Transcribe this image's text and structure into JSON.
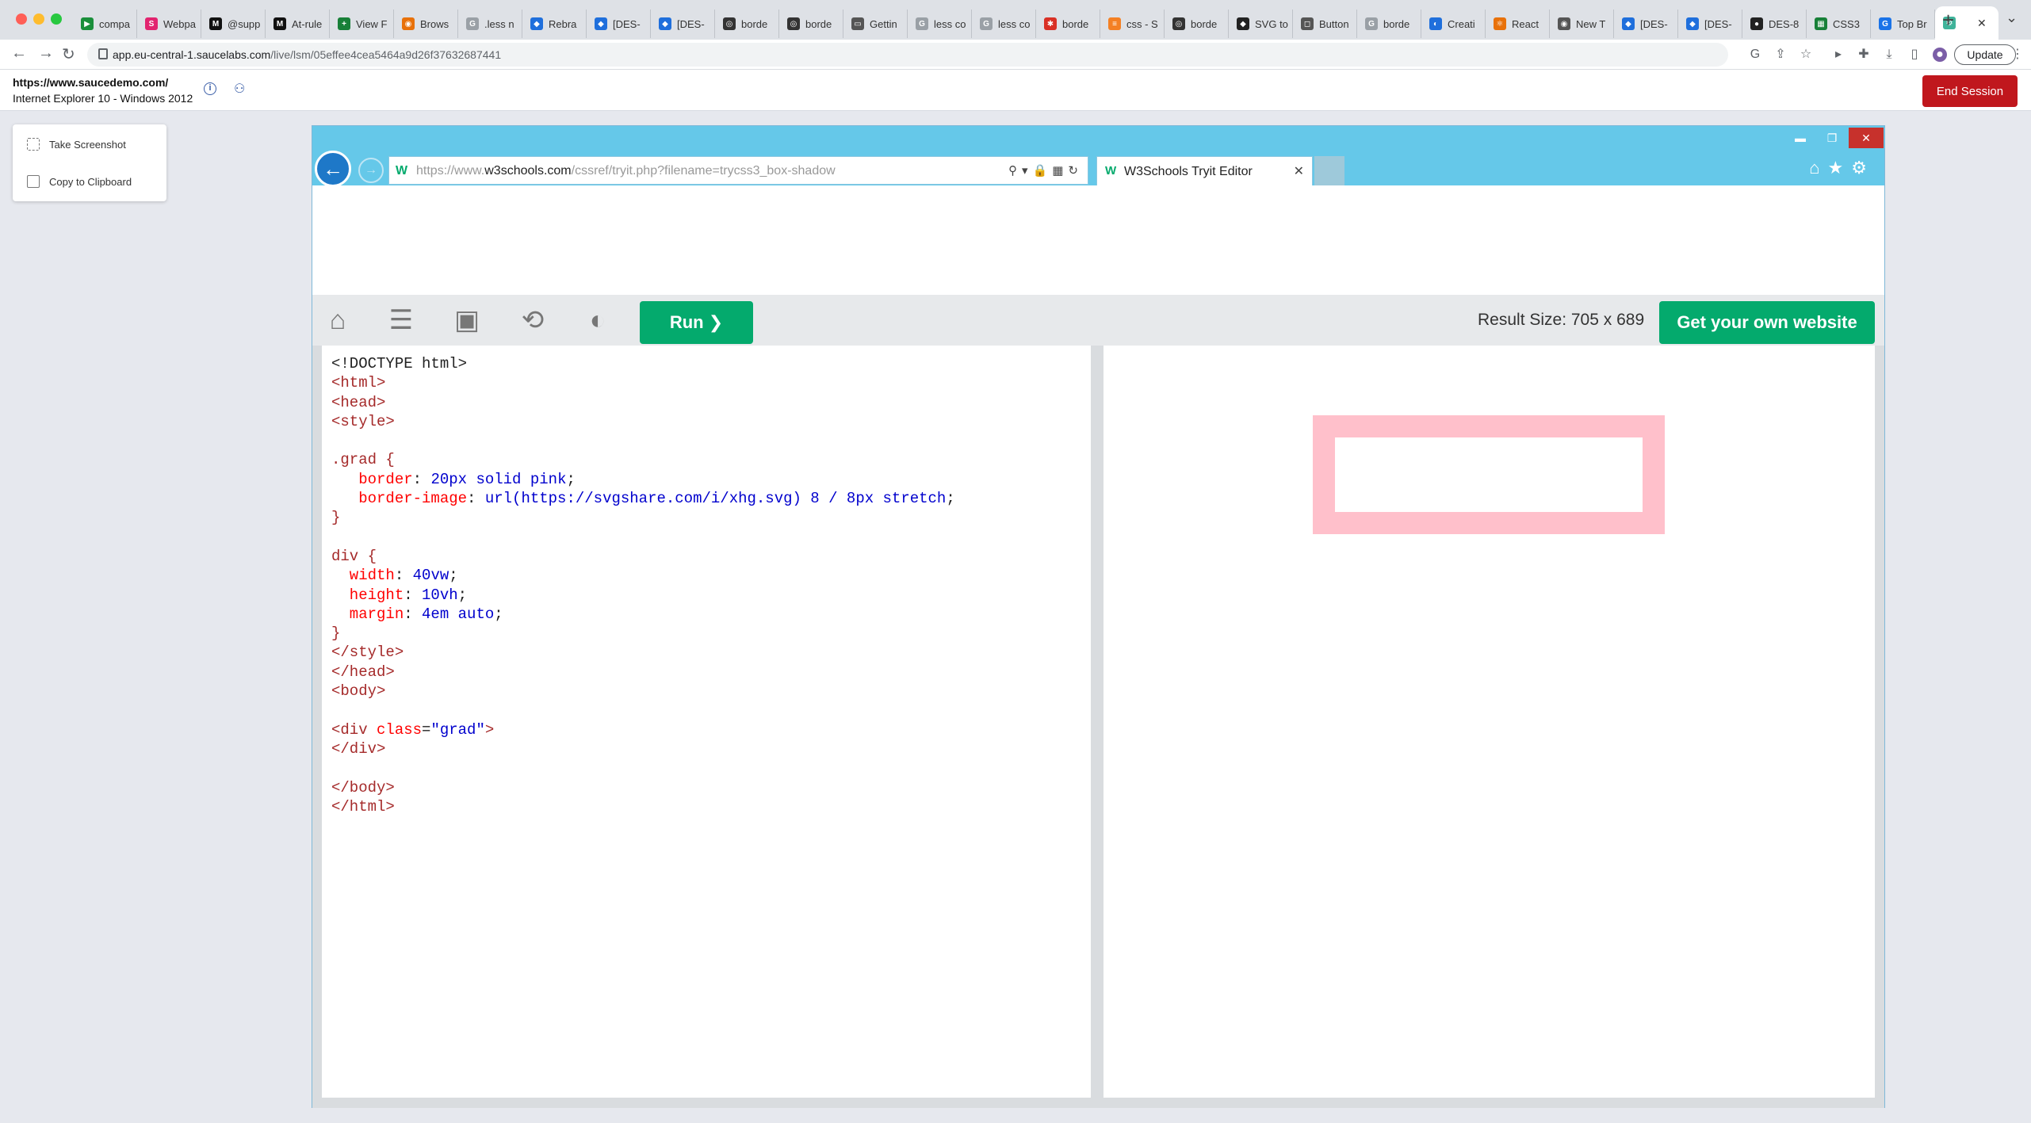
{
  "browser": {
    "tabs": [
      {
        "label": "compa",
        "color": "#1a8f3b",
        "glyph": "▶"
      },
      {
        "label": "Webpa",
        "color": "#e2246f",
        "glyph": "S"
      },
      {
        "label": "@supp",
        "color": "#111111",
        "glyph": "M"
      },
      {
        "label": "At-rule",
        "color": "#111111",
        "glyph": "M"
      },
      {
        "label": "View F",
        "color": "#188038",
        "glyph": "+"
      },
      {
        "label": "Brows",
        "color": "#e8710a",
        "glyph": "◉"
      },
      {
        "label": ".less n",
        "color": "#9aa0a6",
        "glyph": "G"
      },
      {
        "label": "Rebra",
        "color": "#1f6fdc",
        "glyph": "◆"
      },
      {
        "label": "[DES-",
        "color": "#1f6fdc",
        "glyph": "◆"
      },
      {
        "label": "[DES-",
        "color": "#1f6fdc",
        "glyph": "◆"
      },
      {
        "label": "borde",
        "color": "#333333",
        "glyph": "◎"
      },
      {
        "label": "borde",
        "color": "#333333",
        "glyph": "◎"
      },
      {
        "label": "Gettin",
        "color": "#555555",
        "glyph": "▭"
      },
      {
        "label": "less co",
        "color": "#9aa0a6",
        "glyph": "G"
      },
      {
        "label": "less co",
        "color": "#9aa0a6",
        "glyph": "G"
      },
      {
        "label": "borde",
        "color": "#d93025",
        "glyph": "✱"
      },
      {
        "label": "css - S",
        "color": "#f48024",
        "glyph": "≡"
      },
      {
        "label": "borde",
        "color": "#333333",
        "glyph": "◎"
      },
      {
        "label": "SVG to",
        "color": "#222222",
        "glyph": "◆"
      },
      {
        "label": "Button",
        "color": "#555555",
        "glyph": "◻"
      },
      {
        "label": "borde",
        "color": "#9aa0a6",
        "glyph": "G"
      },
      {
        "label": "Creati",
        "color": "#1f6fdc",
        "glyph": "◐"
      },
      {
        "label": "React",
        "color": "#e8710a",
        "glyph": "⚛"
      },
      {
        "label": "New T",
        "color": "#555555",
        "glyph": "◉"
      },
      {
        "label": "[DES-",
        "color": "#1f6fdc",
        "glyph": "◆"
      },
      {
        "label": "[DES-",
        "color": "#1f6fdc",
        "glyph": "◆"
      },
      {
        "label": "DES-8",
        "color": "#222222",
        "glyph": "●"
      },
      {
        "label": "CSS3",
        "color": "#188038",
        "glyph": "▦"
      },
      {
        "label": "Top Br",
        "color": "#1a73e8",
        "glyph": "G"
      }
    ],
    "address": {
      "domain": "app.eu-central-1.saucelabs.com",
      "path": "/live/lsm/05effee4cea5464a9d26f37632687441"
    },
    "update_label": "Update"
  },
  "sauce": {
    "session_url": "https://www.saucedemo.com/",
    "session_os": "Internet Explorer 10 - Windows 2012",
    "end_label": "End Session",
    "panel": {
      "screenshot_label": "Take Screenshot",
      "clipboard_label": "Copy to Clipboard"
    }
  },
  "ie": {
    "url_prefix": "https://www.",
    "url_domain": "w3schools.com",
    "url_path": "/cssref/tryit.php?filename=trycss3_box-shadow",
    "tab_title": "W3Schools Tryit Editor"
  },
  "w3": {
    "run_label": "Run ❯",
    "result_size": "Result Size: 705 x 689",
    "get_website_label": "Get your own website"
  },
  "code_lines": [
    [
      {
        "t": "<!DOCTYPE html>",
        "c": ""
      }
    ],
    [
      {
        "t": "<html>",
        "c": "tag"
      }
    ],
    [
      {
        "t": "<head>",
        "c": "tag"
      }
    ],
    [
      {
        "t": "<style>",
        "c": "tag"
      }
    ],
    [
      {
        "t": "",
        "c": ""
      }
    ],
    [
      {
        "t": ".grad {",
        "c": "sel"
      }
    ],
    [
      {
        "t": "   border",
        "c": "prop"
      },
      {
        "t": ": ",
        "c": ""
      },
      {
        "t": "20px solid pink",
        "c": "val"
      },
      {
        "t": ";",
        "c": ""
      }
    ],
    [
      {
        "t": "   border-image",
        "c": "prop"
      },
      {
        "t": ": ",
        "c": ""
      },
      {
        "t": "url(https://svgshare.com/i/xhg.svg) 8 / 8px stretch",
        "c": "val"
      },
      {
        "t": ";",
        "c": ""
      }
    ],
    [
      {
        "t": "}",
        "c": "sel"
      }
    ],
    [
      {
        "t": "",
        "c": ""
      }
    ],
    [
      {
        "t": "div {",
        "c": "sel"
      }
    ],
    [
      {
        "t": "  width",
        "c": "prop"
      },
      {
        "t": ": ",
        "c": ""
      },
      {
        "t": "40vw",
        "c": "val"
      },
      {
        "t": ";",
        "c": ""
      }
    ],
    [
      {
        "t": "  height",
        "c": "prop"
      },
      {
        "t": ": ",
        "c": ""
      },
      {
        "t": "10vh",
        "c": "val"
      },
      {
        "t": ";",
        "c": ""
      }
    ],
    [
      {
        "t": "  margin",
        "c": "prop"
      },
      {
        "t": ": ",
        "c": ""
      },
      {
        "t": "4em auto",
        "c": "val"
      },
      {
        "t": ";",
        "c": ""
      }
    ],
    [
      {
        "t": "}",
        "c": "sel"
      }
    ],
    [
      {
        "t": "</style>",
        "c": "tag"
      }
    ],
    [
      {
        "t": "</head>",
        "c": "tag"
      }
    ],
    [
      {
        "t": "<body>",
        "c": "tag"
      }
    ],
    [
      {
        "t": "",
        "c": ""
      }
    ],
    [
      {
        "t": "<div ",
        "c": "tag"
      },
      {
        "t": "class",
        "c": "attr"
      },
      {
        "t": "=",
        "c": ""
      },
      {
        "t": "\"grad\"",
        "c": "str"
      },
      {
        "t": ">",
        "c": "tag"
      }
    ],
    [
      {
        "t": "</div>",
        "c": "tag"
      }
    ],
    [
      {
        "t": "",
        "c": ""
      }
    ],
    [
      {
        "t": "</body>",
        "c": "tag"
      }
    ],
    [
      {
        "t": "</html>",
        "c": "tag"
      }
    ]
  ],
  "colors": {
    "accent_green": "#04aa6d",
    "end_session_red": "#c0171d",
    "ie_chrome_blue": "#65c8e9",
    "demo_border_pink": "#ffc0cb"
  }
}
